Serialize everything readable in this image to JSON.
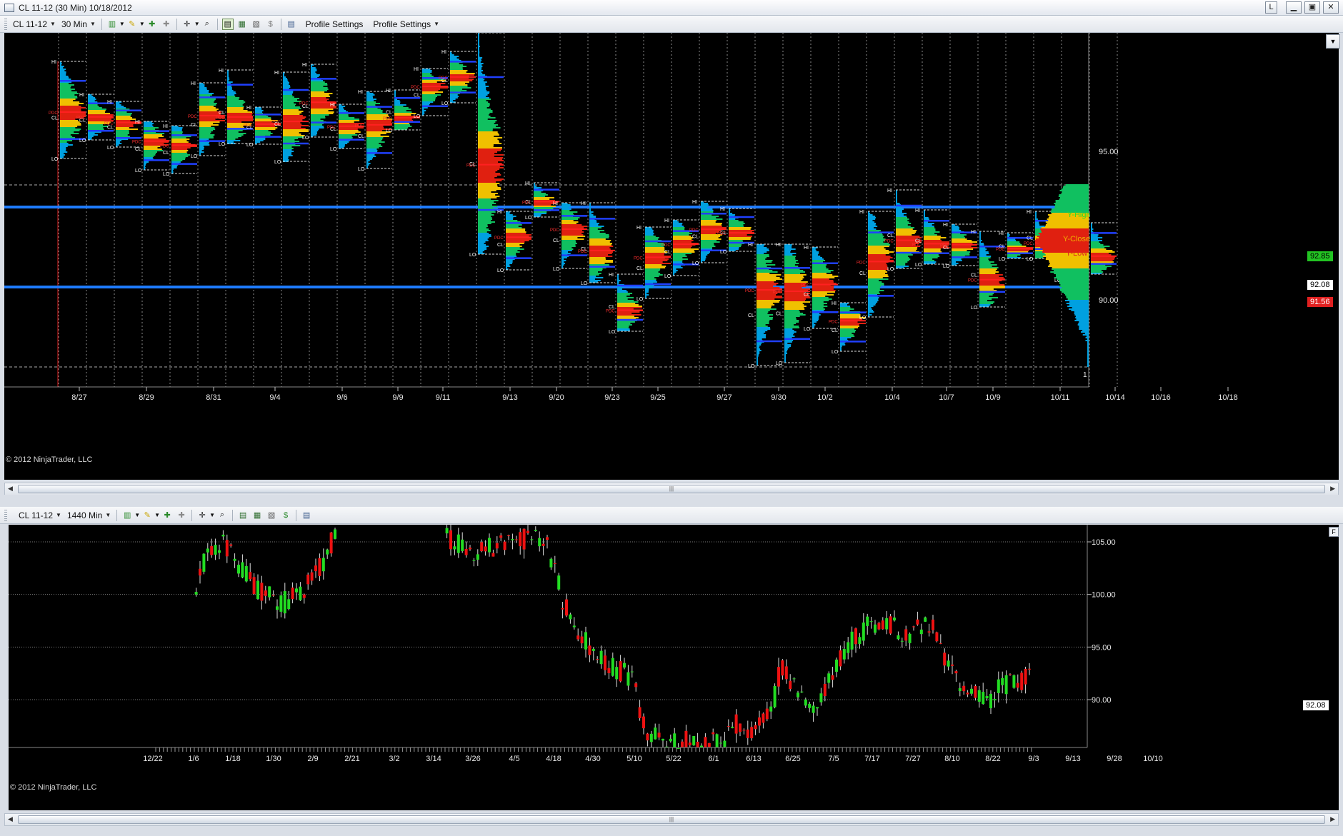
{
  "window": {
    "title": "CL 11-12 (30 Min)  10/18/2012"
  },
  "top_toolbar": {
    "instrument": "CL 11-12",
    "interval": "30 Min",
    "profile_settings_1": "Profile Settings",
    "profile_settings_2": "Profile Settings"
  },
  "bottom_toolbar": {
    "instrument": "CL 11-12",
    "interval": "1440 Min"
  },
  "top_chart": {
    "copyright": "© 2012 NinjaTrader, LLC",
    "date_labels": [
      "8/27",
      "8/29",
      "8/31",
      "9/4",
      "9/6",
      "9/9",
      "9/11",
      "9/13",
      "9/20",
      "9/23",
      "9/25",
      "9/27",
      "9/30",
      "10/2",
      "10/4",
      "10/7",
      "10/9",
      "10/11",
      "10/14",
      "10/16",
      "10/18"
    ],
    "price_labels": [
      "95.00",
      "90.00"
    ],
    "last_price": "92.08",
    "y_high_label": "Y-High",
    "y_high_value": "92.85",
    "y_close_label": "Y-Close",
    "y_low_label": "Y-Low",
    "y_low_value": "91.56",
    "level_labels": {
      "hi": "HI",
      "lo": "LO",
      "cl": "CL",
      "pdc": "PDC"
    },
    "corner_label": "1",
    "colors": {
      "blue_level": "#1e7bff",
      "profile_hot": "#e02010",
      "profile_mid": "#f0c000",
      "profile_cool": "#10c060",
      "profile_cold": "#00a0e0"
    }
  },
  "bottom_chart": {
    "copyright": "© 2012 NinjaTrader, LLC",
    "date_labels": [
      "12/22",
      "1/6",
      "1/18",
      "1/30",
      "2/9",
      "2/21",
      "3/2",
      "3/14",
      "3/26",
      "4/5",
      "4/18",
      "4/30",
      "5/10",
      "5/22",
      "6/1",
      "6/13",
      "6/25",
      "7/5",
      "7/17",
      "7/27",
      "8/10",
      "8/22",
      "9/3",
      "9/13",
      "9/28",
      "10/10"
    ],
    "price_labels": [
      "105.00",
      "100.00",
      "95.00",
      "90.00"
    ],
    "last_price": "92.08",
    "colors": {
      "up": "#22dd22",
      "down": "#ee1111"
    }
  },
  "icons": {
    "f_button": "F",
    "dropdown": "▼"
  }
}
